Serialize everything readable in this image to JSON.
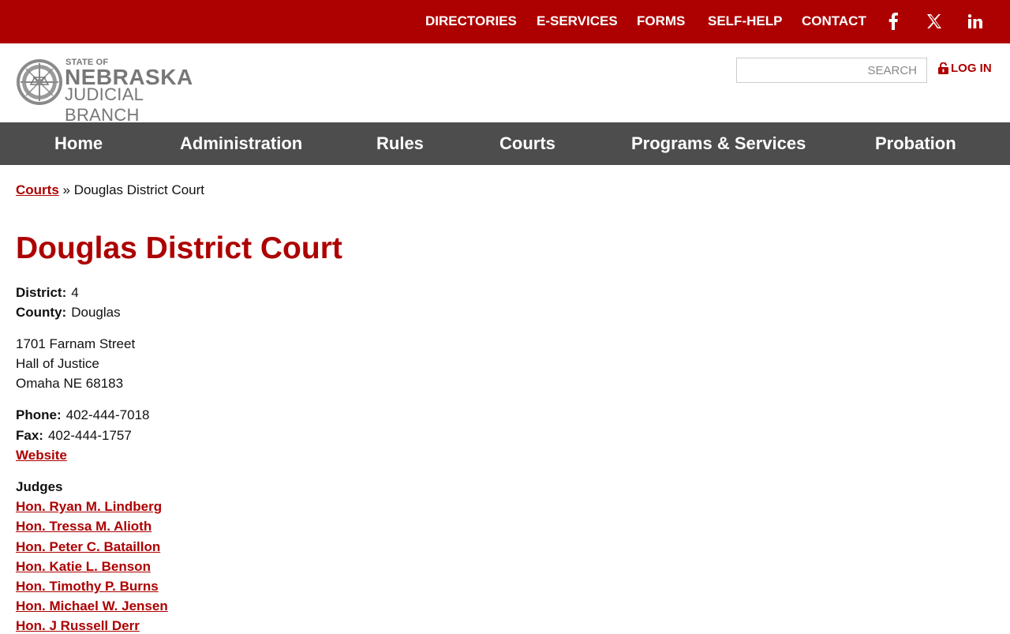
{
  "topnav": {
    "items": [
      {
        "label": "DIRECTORIES"
      },
      {
        "label": "E-SERVICES"
      },
      {
        "label": "FORMS"
      },
      {
        "label": "SELF-HELP"
      },
      {
        "label": "CONTACT"
      }
    ],
    "social": [
      "facebook-icon",
      "x-twitter-icon",
      "linkedin-icon"
    ]
  },
  "header": {
    "logo_small": "STATE OF",
    "logo_big": "NEBRASKA",
    "logo_sub": "JUDICIAL BRANCH",
    "search_placeholder": "SEARCH",
    "login_label": "LOG IN"
  },
  "mainnav": {
    "items": [
      {
        "label": "Home"
      },
      {
        "label": "Administration"
      },
      {
        "label": "Rules"
      },
      {
        "label": "Courts"
      },
      {
        "label": "Programs & Services"
      },
      {
        "label": "Probation"
      }
    ]
  },
  "breadcrumb": {
    "parent": "Courts",
    "separator": " » ",
    "current": "Douglas District Court"
  },
  "court": {
    "title": "Douglas District Court",
    "district_label": "District:",
    "district": "4",
    "county_label": "County:",
    "county": "Douglas",
    "address": [
      "1701 Farnam Street",
      "Hall of Justice",
      "Omaha NE 68183"
    ],
    "phone_label": "Phone:",
    "phone": "402-444-7018",
    "fax_label": "Fax:",
    "fax": "402-444-1757",
    "website_label": "Website",
    "judges_heading": "Judges",
    "judges": [
      "Hon. Ryan M. Lindberg",
      "Hon. Tressa M. Alioth",
      "Hon. Peter C. Bataillon",
      "Hon. Katie L. Benson",
      "Hon. Timothy P. Burns",
      "Hon. Michael W. Jensen",
      "Hon. J Russell Derr"
    ]
  },
  "colors": {
    "brand_red": "#ad0000",
    "nav_gray": "#4d4d4d"
  }
}
